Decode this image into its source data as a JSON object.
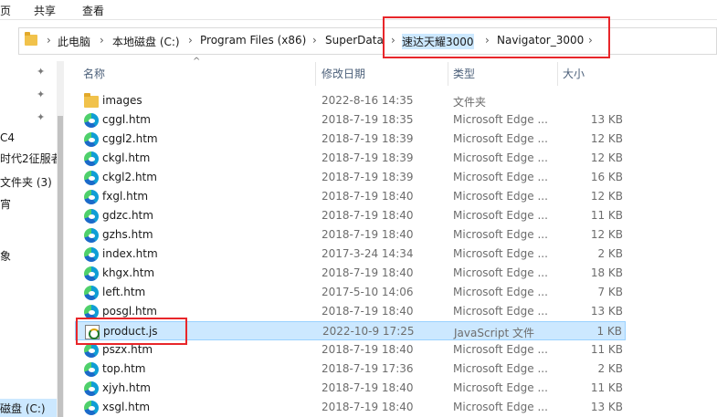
{
  "ribbon": {
    "tabs": [
      "页",
      "共享",
      "查看"
    ]
  },
  "address": {
    "crumbs": [
      "此电脑",
      "本地磁盘 (C:)",
      "Program Files (x86)",
      "SuperData",
      "速达天耀3000",
      "Navigator_3000"
    ]
  },
  "nav": {
    "items": [
      "C4",
      "时代2征服者",
      "文件夹 (3)",
      "宵",
      "象",
      "磁盘 (C:)"
    ]
  },
  "columns": {
    "name": "名称",
    "date": "修改日期",
    "type": "类型",
    "size": "大小"
  },
  "files": [
    {
      "name": "images",
      "date": "2022-8-16 14:35",
      "type": "文件夹",
      "size": "",
      "icon": "folder-icon"
    },
    {
      "name": "cggl.htm",
      "date": "2018-7-19 18:35",
      "type": "Microsoft Edge ...",
      "size": "13 KB",
      "icon": "edge-icon"
    },
    {
      "name": "cggl2.htm",
      "date": "2018-7-19 18:39",
      "type": "Microsoft Edge ...",
      "size": "12 KB",
      "icon": "edge-icon"
    },
    {
      "name": "ckgl.htm",
      "date": "2018-7-19 18:39",
      "type": "Microsoft Edge ...",
      "size": "12 KB",
      "icon": "edge-icon"
    },
    {
      "name": "ckgl2.htm",
      "date": "2018-7-19 18:39",
      "type": "Microsoft Edge ...",
      "size": "16 KB",
      "icon": "edge-icon"
    },
    {
      "name": "fxgl.htm",
      "date": "2018-7-19 18:40",
      "type": "Microsoft Edge ...",
      "size": "12 KB",
      "icon": "edge-icon"
    },
    {
      "name": "gdzc.htm",
      "date": "2018-7-19 18:40",
      "type": "Microsoft Edge ...",
      "size": "11 KB",
      "icon": "edge-icon"
    },
    {
      "name": "gzhs.htm",
      "date": "2018-7-19 18:40",
      "type": "Microsoft Edge ...",
      "size": "12 KB",
      "icon": "edge-icon"
    },
    {
      "name": "index.htm",
      "date": "2017-3-24 14:34",
      "type": "Microsoft Edge ...",
      "size": "2 KB",
      "icon": "edge-icon"
    },
    {
      "name": "khgx.htm",
      "date": "2018-7-19 18:40",
      "type": "Microsoft Edge ...",
      "size": "18 KB",
      "icon": "edge-icon"
    },
    {
      "name": "left.htm",
      "date": "2017-5-10 14:06",
      "type": "Microsoft Edge ...",
      "size": "7 KB",
      "icon": "edge-icon"
    },
    {
      "name": "posgl.htm",
      "date": "2018-7-19 18:40",
      "type": "Microsoft Edge ...",
      "size": "13 KB",
      "icon": "edge-icon"
    },
    {
      "name": "product.js",
      "date": "2022-10-9 17:25",
      "type": "JavaScript 文件",
      "size": "1 KB",
      "icon": "js-file-icon",
      "selected": true
    },
    {
      "name": "pszx.htm",
      "date": "2018-7-19 18:40",
      "type": "Microsoft Edge ...",
      "size": "11 KB",
      "icon": "edge-icon"
    },
    {
      "name": "top.htm",
      "date": "2018-7-19 17:36",
      "type": "Microsoft Edge ...",
      "size": "2 KB",
      "icon": "edge-icon"
    },
    {
      "name": "xjyh.htm",
      "date": "2018-7-19 18:40",
      "type": "Microsoft Edge ...",
      "size": "11 KB",
      "icon": "edge-icon"
    },
    {
      "name": "xsgl.htm",
      "date": "2018-7-19 18:40",
      "type": "Microsoft Edge ...",
      "size": "13 KB",
      "icon": "edge-icon"
    }
  ],
  "colors": {
    "selection": "#cce8ff",
    "highlight": "#e8262a"
  }
}
